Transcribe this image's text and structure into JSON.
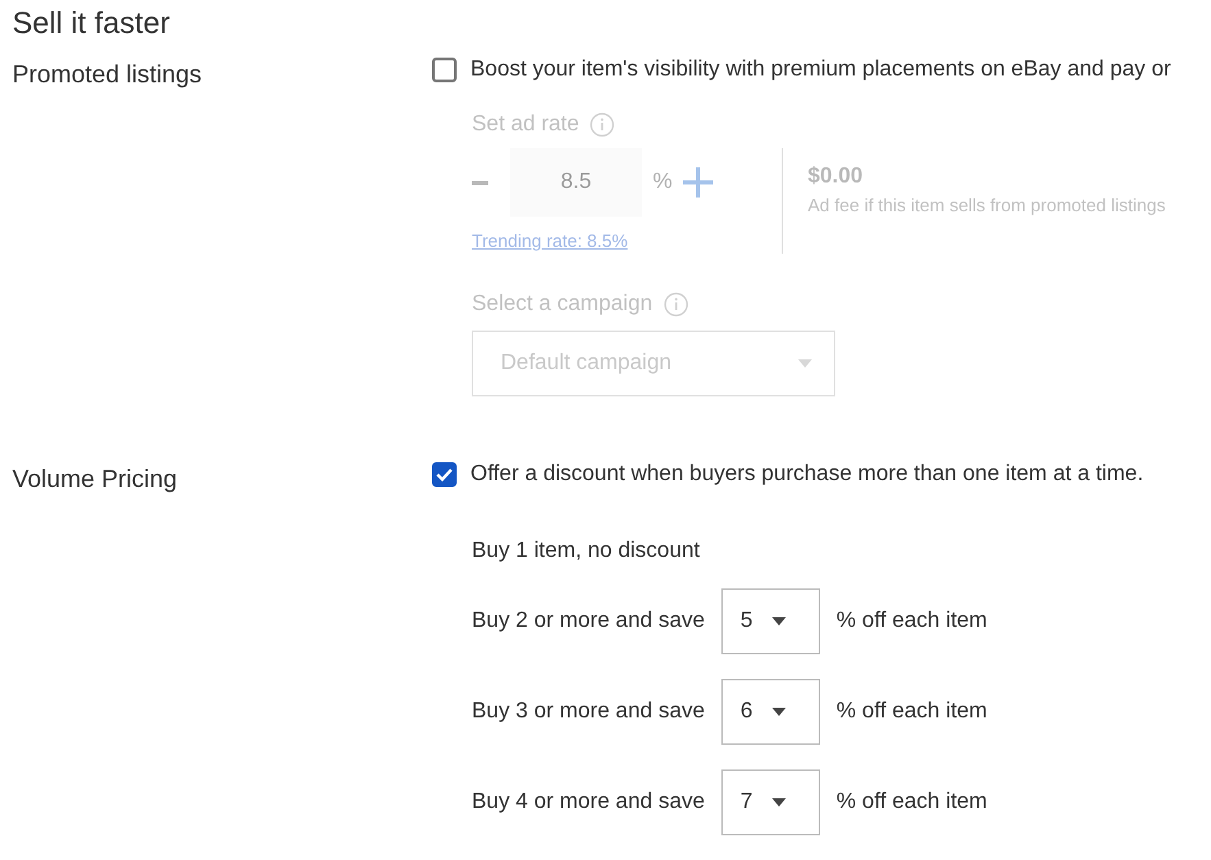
{
  "heading": "Sell it faster",
  "promoted": {
    "label": "Promoted listings",
    "checked": false,
    "description": "Boost your item's visibility with premium placements on eBay and pay or",
    "ad_rate": {
      "label": "Set ad rate",
      "value": "8.5",
      "unit": "%",
      "trending_link": "Trending rate: 8.5%"
    },
    "fee": {
      "amount": "$0.00",
      "note": "Ad fee if this item sells from promoted listings"
    },
    "campaign": {
      "label": "Select a campaign",
      "value": "Default campaign"
    }
  },
  "volume": {
    "label": "Volume Pricing",
    "checked": true,
    "description": "Offer a discount when buyers purchase more than one item at a time.",
    "base_tier": "Buy 1 item, no discount",
    "tiers": [
      {
        "label": "Buy 2 or more and save",
        "value": "5",
        "suffix": "% off each item"
      },
      {
        "label": "Buy 3 or more and save",
        "value": "6",
        "suffix": "% off each item"
      },
      {
        "label": "Buy 4 or more and save",
        "value": "7",
        "suffix": "% off each item"
      }
    ]
  }
}
